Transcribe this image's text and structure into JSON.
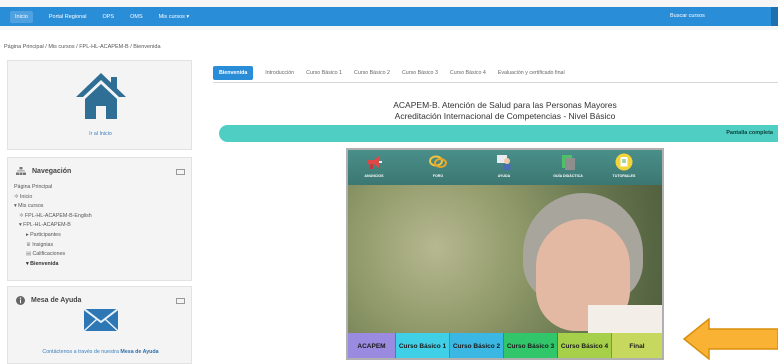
{
  "navbar": {
    "items": [
      "Inicio",
      "Portal Regional",
      "OPS",
      "OMS",
      "Mis cursos ▾"
    ],
    "search_label": "Buscar cursos"
  },
  "breadcrumb": "Página Principal  /  Mis cursos  /  FPL-HL-ACAPEM-B  /  Bienvenida",
  "home_block": {
    "link": "Ir al Inicio"
  },
  "nav_block": {
    "title": "Navegación",
    "items": [
      "Página Principal",
      "Inicio",
      "Mis cursos",
      "FPL-HL-ACAPEM-B-English",
      "FPL-HL-ACAPEM-B",
      "Participantes",
      "Insignias",
      "Calificaciones",
      "Bienvenida"
    ]
  },
  "help_block": {
    "title": "Mesa de Ayuda",
    "text_prefix": "Contáctenos a través de nuestra ",
    "text_link": "Mesa de Ayuda"
  },
  "tabs": [
    "Bienvenida",
    "Introducción",
    "Curso Básico 1",
    "Curso Básico 2",
    "Curso Básico 3",
    "Curso Básico 4",
    "Evaluación y certificado final"
  ],
  "course_title_line1": "ACAPEM-B. Atención de Salud para las Personas Mayores",
  "course_title_line2": "Acreditación Internacional de Competencias - Nivel Básico",
  "fullscreen_label": "Pantalla completa",
  "panel_icons": [
    {
      "label": "ANUNCIOS",
      "icon": "megaphone-icon"
    },
    {
      "label": "FORO",
      "icon": "chat-bubbles-icon"
    },
    {
      "label": "AYUDA",
      "icon": "help-person-icon"
    },
    {
      "label": "GUÍA DIDÁCTICA",
      "icon": "guide-document-icon"
    },
    {
      "label": "TUTORIALES",
      "icon": "tutorial-doc-icon"
    }
  ],
  "course_buttons": [
    {
      "label": "ACAPEM",
      "color": "#9a8ae0"
    },
    {
      "label": "Curso Básico 1",
      "color": "#3fd0e8"
    },
    {
      "label": "Curso Básico 2",
      "color": "#3ab7e2"
    },
    {
      "label": "Curso Básico 3",
      "color": "#31c66a"
    },
    {
      "label": "Curso Básico 4",
      "color": "#a6cf4a"
    },
    {
      "label": "Final",
      "color": "#c7d85e"
    }
  ],
  "colors": {
    "navbar": "#2a8dd8",
    "fullscreen_bar": "#4fcfc3",
    "arrow": "#f9b233",
    "home_icon": "#2f6f95",
    "mail_icon": "#2c77b4"
  }
}
